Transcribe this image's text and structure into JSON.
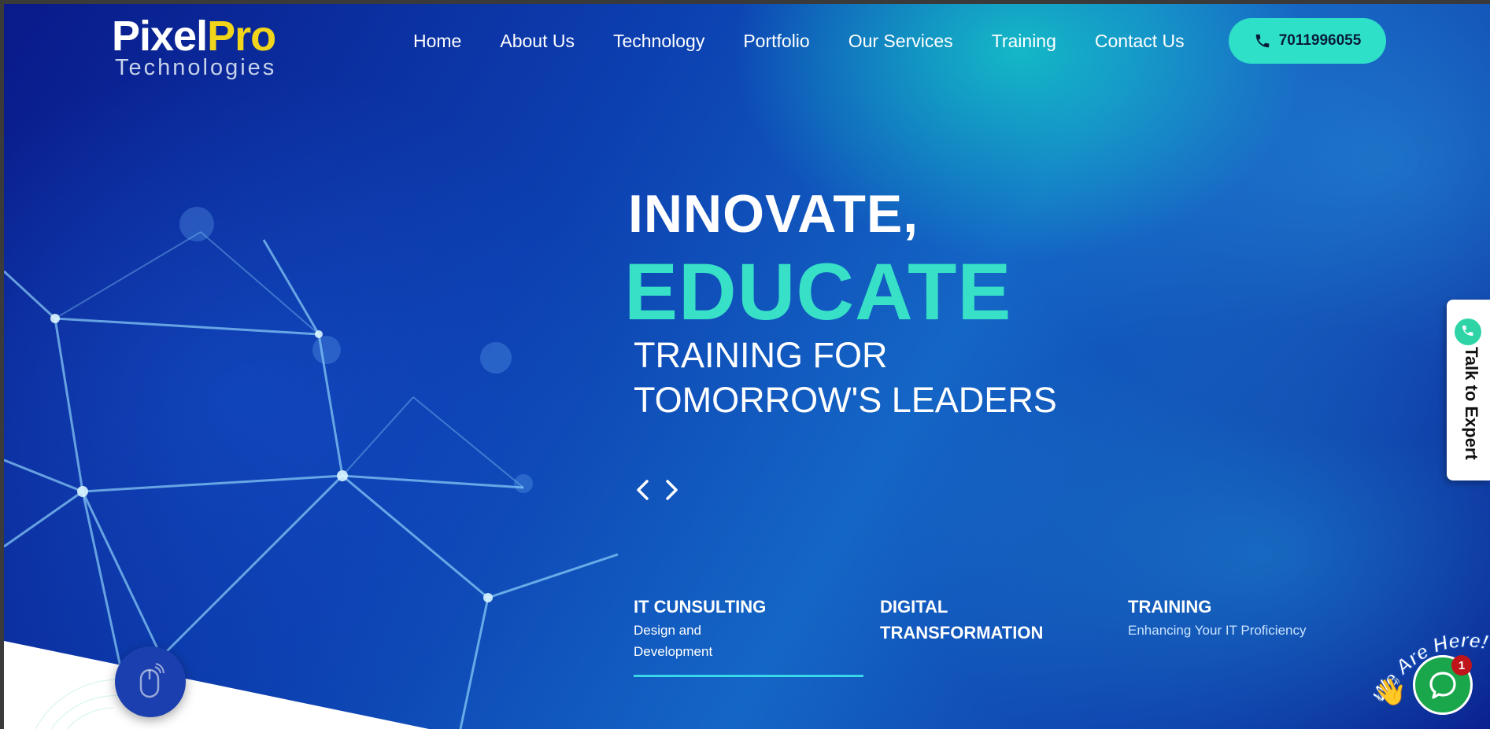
{
  "logo": {
    "part1": "Pixel",
    "part2": "Pro",
    "subtitle": "Technologies"
  },
  "nav": {
    "items": [
      "Home",
      "About Us",
      "Technology",
      "Portfolio",
      "Our Services",
      "Training",
      "Contact Us"
    ]
  },
  "header": {
    "phone": "7011996055"
  },
  "hero": {
    "line1": "INNOVATE,",
    "line2": "EDUCATE",
    "line3a": "TRAINING FOR",
    "line3b": "TOMORROW'S LEADERS"
  },
  "services": [
    {
      "title": "IT CUNSULTING",
      "subtitle_line1": "Design and",
      "subtitle_line2": "Development"
    },
    {
      "title_line1": "DIGITAL",
      "title_line2": "TRANSFORMATION"
    },
    {
      "title": "TRAINING",
      "subtitle": "Enhancing Your IT Proficiency"
    }
  ],
  "side_tab": {
    "label": "Talk to Expert"
  },
  "chat": {
    "tagline": "We Are Here!",
    "badge_count": "1",
    "wave_emoji": "👋"
  },
  "colors": {
    "accent": "#37e0c6",
    "phone_button": "#2ee0c8",
    "logo_yellow": "#f1d51a",
    "chat_green": "#1aa64a"
  },
  "icons": [
    "phone-icon",
    "chevron-left-icon",
    "chevron-right-icon",
    "mouse-icon",
    "chat-bubble-icon",
    "phone-circle-icon"
  ]
}
